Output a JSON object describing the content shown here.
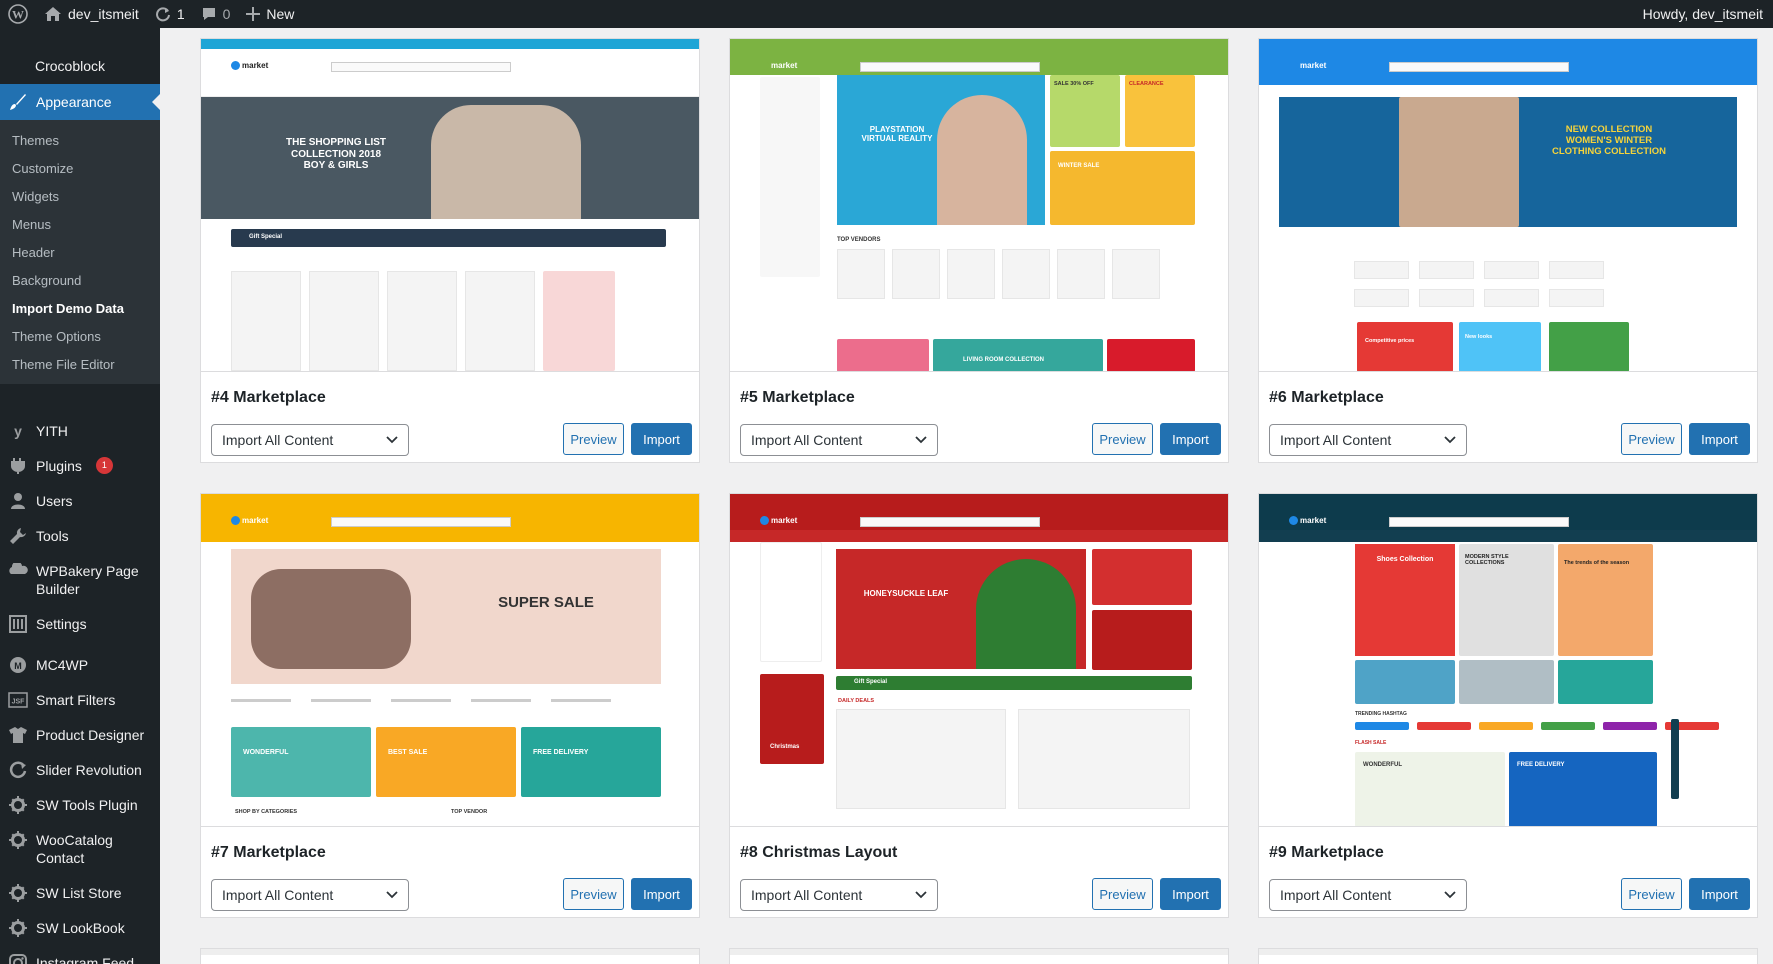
{
  "admin_bar": {
    "site_name": "dev_itsmeit",
    "updates_count": "1",
    "comments_count": "0",
    "new_label": "New",
    "greeting": "Howdy, dev_itsmeit"
  },
  "sidebar": {
    "top_item": "Crocoblock",
    "active_menu": "Appearance",
    "submenu": [
      "Themes",
      "Customize",
      "Widgets",
      "Menus",
      "Header",
      "Background",
      "Import Demo Data",
      "Theme Options",
      "Theme File Editor"
    ],
    "current_submenu": "Import Demo Data",
    "menu": [
      {
        "label": "YITH",
        "icon": "yith-icon"
      },
      {
        "label": "Plugins",
        "icon": "plugin-icon",
        "badge": "1"
      },
      {
        "label": "Users",
        "icon": "users-icon"
      },
      {
        "label": "Tools",
        "icon": "wrench-icon"
      },
      {
        "label": "WPBakery Page Builder",
        "icon": "wpbakery-icon"
      },
      {
        "label": "Settings",
        "icon": "settings-icon"
      },
      {
        "label": "MC4WP",
        "icon": "mc4wp-icon"
      },
      {
        "label": "Smart Filters",
        "icon": "filter-icon"
      },
      {
        "label": "Product Designer",
        "icon": "designer-icon"
      },
      {
        "label": "Slider Revolution",
        "icon": "slider-icon"
      },
      {
        "label": "SW Tools Plugin",
        "icon": "gear-icon"
      },
      {
        "label": "WooCatalog Contact",
        "icon": "gear-icon"
      },
      {
        "label": "SW List Store",
        "icon": "gear-icon"
      },
      {
        "label": "SW LookBook",
        "icon": "gear-icon"
      },
      {
        "label": "Instagram Feed",
        "icon": "instagram-icon"
      }
    ]
  },
  "demos": [
    {
      "title": "#4 Marketplace",
      "select_value": "Import All Content",
      "preview_label": "Preview",
      "import_label": "Import",
      "thumb": {
        "topbar": "#1ea5d6",
        "banner_bg": "#4a5862",
        "banner_lines": [
          "THE SHOPPING LIST",
          "COLLECTION 2018",
          "BOY & GIRLS"
        ],
        "banner_text_color": "#ffffff",
        "strip_label": "Gift Special",
        "strip_bg": "#283a4e"
      }
    },
    {
      "title": "#5 Marketplace",
      "select_value": "Import All Content",
      "preview_label": "Preview",
      "import_label": "Import",
      "thumb": {
        "topbar": "#7cb342",
        "banner_bg": "#2aa7d6",
        "banner_lines": [
          "PLAYSTATION",
          "VIRTUAL REALITY"
        ],
        "banner_text_color": "#ffffff",
        "promo_1": "SALE 30% OFF",
        "promo_2": "CLEARANCE",
        "promo_3": "WINTER SALE",
        "vendors_label": "TOP VENDORS",
        "bottom_label": "LIVING ROOM COLLECTION"
      }
    },
    {
      "title": "#6 Marketplace",
      "select_value": "Import All Content",
      "preview_label": "Preview",
      "import_label": "Import",
      "thumb": {
        "topbar": "#1e88e5",
        "banner_bg": "#16659c",
        "banner_lines": [
          "NEW COLLECTION",
          "WOMEN'S WINTER",
          "CLOTHING COLLECTION"
        ],
        "banner_text_color": "#f5d33b",
        "promo_1": "Competitive prices",
        "promo_2": "New looks"
      }
    },
    {
      "title": "#7 Marketplace",
      "select_value": "Import All Content",
      "preview_label": "Preview",
      "import_label": "Import",
      "thumb": {
        "topbar": "#f7b500",
        "banner_bg": "#f1d7cc",
        "banner_lines": [
          "SUPER SALE"
        ],
        "banner_text_color": "#333333",
        "promo_1": "WONDERFUL",
        "promo_2": "BEST SALE",
        "promo_3": "FREE DELIVERY",
        "section_1": "SHOP BY CATEGORIES",
        "section_2": "TOP VENDOR"
      }
    },
    {
      "title": "#8 Christmas Layout",
      "select_value": "Import All Content",
      "preview_label": "Preview",
      "import_label": "Import",
      "thumb": {
        "topbar": "#b71c1c",
        "banner_bg": "#c62828",
        "banner_lines": [
          "HONEYSUCKLE LEAF"
        ],
        "banner_text_color": "#ffffff",
        "strip_label": "Gift Special",
        "strip_bg": "#2e7d32",
        "side_label": "Christmas",
        "deals_label": "DAILY DEALS"
      }
    },
    {
      "title": "#9 Marketplace",
      "select_value": "Import All Content",
      "preview_label": "Preview",
      "import_label": "Import",
      "thumb": {
        "topbar": "#0d3b4c",
        "banner_bg": "#e53935",
        "banner_lines": [
          "Shoes Collection"
        ],
        "banner_text_color": "#ffffff",
        "promo_1": "MODERN STYLE COLLECTIONS",
        "promo_2": "The trends of the season",
        "promo_3": "WONDERFUL",
        "promo_4": "FREE DELIVERY",
        "trending_label": "TRENDING HASHTAG",
        "flash_label": "FLASH SALE"
      }
    }
  ]
}
